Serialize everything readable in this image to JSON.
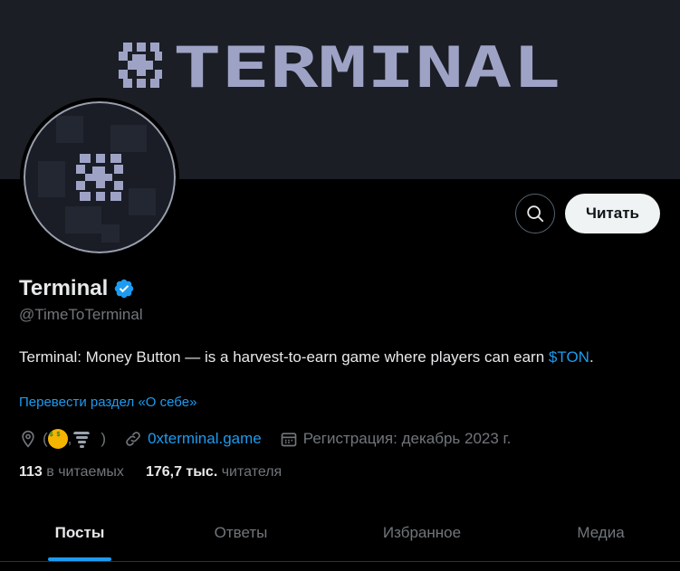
{
  "banner": {
    "logo_text": "TERMINAL",
    "logo_color": "#9ea3c6"
  },
  "header": {
    "search_icon": "search-icon",
    "follow_label": "Читать"
  },
  "profile": {
    "name": "Terminal",
    "handle": "@TimeToTerminal",
    "bio_text": "Terminal: Money Button — is a harvest-to-earn game where players can earn",
    "bio_cashtag": "$TON",
    "bio_suffix": ".",
    "translate_label": "Перевести раздел «О себе»",
    "location_open": "(",
    "location_sep": ",",
    "location_close": ")",
    "website": "0xterminal.game",
    "joined": "Регистрация: декабрь 2023 г."
  },
  "stats": {
    "following_count": "113",
    "following_label": "в читаемых",
    "followers_count": "176,7 тыс.",
    "followers_label": "читателя"
  },
  "tabs": [
    {
      "label": "Посты"
    },
    {
      "label": "Ответы"
    },
    {
      "label": "Избранное"
    },
    {
      "label": "Медиа"
    }
  ],
  "colors": {
    "accent": "#1d9bf0",
    "verified": "#1d9bf0",
    "muted": "#71767b"
  }
}
